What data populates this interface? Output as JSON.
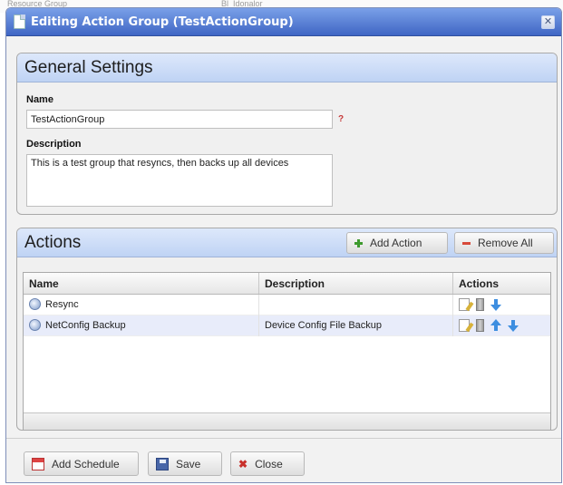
{
  "background": {
    "left_text": "Resource Group",
    "right_text": "Bl_Idonalor"
  },
  "dialog": {
    "title": "Editing Action Group (TestActionGroup)",
    "close_glyph": "✕"
  },
  "general": {
    "title": "General Settings",
    "name_label": "Name",
    "name_value": "TestActionGroup",
    "required_mark": "?",
    "description_label": "Description",
    "description_value": "This is a test group that resyncs, then backs up all devices"
  },
  "actions_panel": {
    "title": "Actions",
    "add_action_label": "Add Action",
    "remove_all_label": "Remove All",
    "columns": [
      "Name",
      "Description",
      "Actions"
    ],
    "rows": [
      {
        "name": "Resync",
        "description": "",
        "controls": [
          "edit-icon",
          "trash-icon",
          "arrow-down-icon"
        ]
      },
      {
        "name": "NetConfig Backup",
        "description": "Device Config File Backup",
        "controls": [
          "edit-icon",
          "trash-icon",
          "arrow-up-icon",
          "arrow-down-icon"
        ]
      }
    ]
  },
  "footer": {
    "add_schedule_label": "Add Schedule",
    "save_label": "Save",
    "close_label": "Close"
  },
  "colors": {
    "titlebar": "#3f66c4",
    "panel_header": "#cdddf7",
    "selected_row": "#e8ecfa",
    "arrow_blue": "#3d8ee0"
  }
}
